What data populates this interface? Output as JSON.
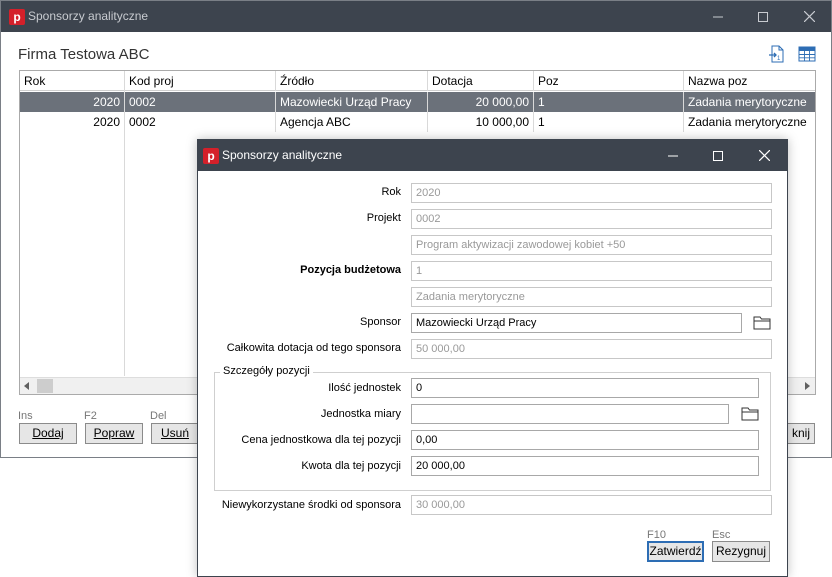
{
  "main": {
    "window_title": "Sponsorzy analityczne",
    "heading": "Firma Testowa ABC",
    "columns": [
      "Rok",
      "Kod proj",
      "Źródło",
      "Dotacja",
      "Poz",
      "Nazwa poz"
    ],
    "rows": [
      [
        "2020",
        "0002",
        "Mazowiecki Urząd Pracy",
        "20 000,00",
        "1",
        "Zadania merytoryczne"
      ],
      [
        "2020",
        "0002",
        "Agencja ABC",
        "10 000,00",
        "1",
        "Zadania merytoryczne"
      ]
    ],
    "hotkeys": {
      "add": "Ins",
      "edit": "F2",
      "delete": "Del"
    },
    "buttons": {
      "add": "Dodaj",
      "edit": "Popraw",
      "delete": "Usuń",
      "close_partial": "knij"
    }
  },
  "dialog": {
    "window_title": "Sponsorzy analityczne",
    "labels": {
      "rok": "Rok",
      "projekt": "Projekt",
      "pozycja": "Pozycja budżetowa",
      "sponsor": "Sponsor",
      "calkowita": "Całkowita dotacja od tego sponsora",
      "szczegoly": "Szczegóły pozycji",
      "ilosc": "Ilość jednostek",
      "jednostka": "Jednostka miary",
      "cena": "Cena jednostkowa dla tej pozycji",
      "kwota": "Kwota dla tej pozycji",
      "niewykorzystane": "Niewykorzystane środki od sponsora"
    },
    "values": {
      "rok": "2020",
      "projekt": "0002",
      "projekt_nazwa": "Program aktywizacji zawodowej kobiet +50",
      "pozycja": "1",
      "pozycja_nazwa": "Zadania merytoryczne",
      "sponsor": "Mazowiecki Urząd Pracy",
      "calkowita": "50 000,00",
      "ilosc": "0",
      "jednostka": "",
      "cena": "0,00",
      "kwota": "20 000,00",
      "niewykorzystane": "30 000,00"
    },
    "hotkeys": {
      "confirm": "F10",
      "cancel": "Esc"
    },
    "buttons": {
      "confirm": "Zatwierdź",
      "cancel": "Rezygnuj"
    }
  },
  "icons": [
    "app-logo-icon",
    "minimize-icon",
    "maximize-icon",
    "close-icon",
    "export-icon",
    "table-icon",
    "folder-icon"
  ],
  "colors": {
    "titlebar": "#3d444e",
    "selected_row": "#6b717a",
    "logo": "#d4202a"
  }
}
